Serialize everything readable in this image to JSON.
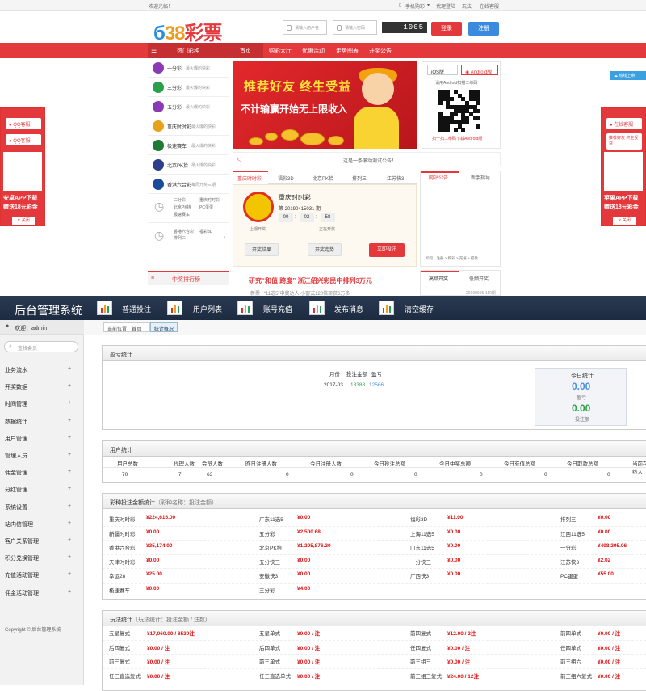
{
  "store": {
    "welcome": "欢迎光临！",
    "top_links": [
      "手机购彩",
      "代理登陆",
      "玩法",
      "在线客服"
    ],
    "logo": {
      "p1": "б",
      "p2": "38",
      "p3": "彩票"
    },
    "username_placeholder": "请输入用户名",
    "password_placeholder": "请输入密码",
    "captcha": "1005",
    "login_label": "登录",
    "register_label": "注册",
    "hot_lottery": "热门彩种",
    "nav": [
      "首页",
      "购彩大厅",
      "优惠活动",
      "走势图表",
      "开奖公告"
    ],
    "lotteries": [
      {
        "name": "一分彩",
        "desc": "最火爆的快彩",
        "color": "#8a3bb3"
      },
      {
        "name": "三分彩",
        "desc": "最火爆的快彩",
        "color": "#2aa04a"
      },
      {
        "name": "五分彩",
        "desc": "最火爆的快彩",
        "color": "#8a3bb3"
      },
      {
        "name": "重庆时时彩",
        "desc": "最火爆的快彩",
        "color": "#e6a21a"
      },
      {
        "name": "极速赛车",
        "desc": "最火爆的快彩",
        "color": "#1e7a34"
      },
      {
        "name": "北京PK拾",
        "desc": "最火爆的快彩",
        "color": "#2d3f8a"
      },
      {
        "name": "香港六合彩",
        "desc": "每周开奖三期",
        "color": "#1a4c9a"
      }
    ],
    "clock_items": [
      "三分彩",
      "重庆时时彩",
      "北京PK拾",
      "PC蛋蛋",
      "极速赛车"
    ],
    "clock_items2": [
      "香港六合彩",
      "福彩3D",
      "排列三"
    ],
    "rank_title": "中奖排行榜",
    "banner_line1": "推荐好友 终生受益",
    "banner_line2": "不计输赢开始无上限收入",
    "ios_label": "iOS版",
    "android_label": "Android版",
    "android_caption": "请用Android扫描二维码",
    "android_download": "扫一扫二维码下载Android版",
    "notice": "这是一条滚动测试公告！",
    "tabs": [
      "重庆时时彩",
      "福彩3D",
      "北京PK拾",
      "排列三",
      "江苏快3"
    ],
    "draw": {
      "name": "重庆时时彩",
      "issue": "第 20190415031 期",
      "timer": [
        "00",
        "02",
        "58"
      ],
      "prev_label": "上期开奖",
      "status": "正在开奖",
      "result_btn": "开奖结果",
      "trend_btn": "开奖走势",
      "bet_btn": "立即投注"
    },
    "news_tabs": [
      "网站公告",
      "新手指导"
    ],
    "news_links": "如何：注册 > 购彩 > 充值 > 提款",
    "headline": "研究“和值 跨度” 浙江绍兴彩民中排列3万元",
    "headline_sub": "新票  |  “11选5”中奖达人 小窗式120倍斩获6万多",
    "right_tabs": [
      "高频开奖",
      "低频开奖"
    ],
    "right_issue": "20190605-110期",
    "help_label": "热线上帝",
    "float_left": {
      "qq1": "QQ客服",
      "qq2": "QQ客服",
      "title": "安卓APP下载",
      "gift": "赠送18元彩金",
      "close": "关闭"
    },
    "float_right": {
      "qq1": "在线客服",
      "promo": "推荐好友 终生受益",
      "title": "苹果APP下载",
      "gift": "赠送18元彩金",
      "close": "关闭"
    }
  },
  "admin": {
    "title": "后台管理系统",
    "menu": [
      "普通投注",
      "用户列表",
      "账号充值",
      "发布消息",
      "清空缓存"
    ],
    "welcome": "欢迎：admin",
    "search_placeholder": "查找会员",
    "sidebar": [
      "业务流水",
      "开奖数据",
      "时间管理",
      "数据统计",
      "用户管理",
      "管理人员",
      "佣金管理",
      "分红管理",
      "系统设置",
      "站内信管理",
      "客户关系管理",
      "积分兑换管理",
      "充值活动管理",
      "佣金活动管理"
    ],
    "copyright": "Copyright © 后台管理系统",
    "crumb_label": "当前位置：首页",
    "crumb_tab": "统计概况",
    "profit": {
      "title": "盈亏统计",
      "headers": [
        "月份",
        "投注金额",
        "盈亏"
      ],
      "row": [
        "2017-03",
        "18388",
        "12566"
      ],
      "today_title": "今日统计",
      "today_profit": "0.00",
      "today_profit_label": "盈亏",
      "today_bet": "0.00",
      "today_bet_label": "投注额"
    },
    "users": {
      "title": "用户统计",
      "headers": [
        "用户总数",
        "代理人数",
        "会员人数",
        "昨日注册人数",
        "今日注册人数",
        "今日投注总额",
        "今日中奖总额",
        "今日充值总额",
        "今日取款总额",
        "当前在线人"
      ],
      "values": [
        "70",
        "7",
        "63",
        "0",
        "0",
        "0",
        "0",
        "0",
        "0",
        "0"
      ]
    },
    "lottery_stats": {
      "title": "彩种投注金额统计",
      "subtitle": "（彩种名称：投注金额）",
      "columns": [
        [
          [
            "重庆时时彩",
            "¥224,616.00"
          ],
          [
            "新疆时时彩",
            "¥0.00"
          ],
          [
            "香港六合彩",
            "¥35,174.00"
          ],
          [
            "天津时时彩",
            "¥0.00"
          ],
          [
            "幸运28",
            "¥25.00"
          ],
          [
            "极速赛车",
            "¥0.00"
          ]
        ],
        [
          [
            "广东11选5",
            "¥0.00"
          ],
          [
            "五分彩",
            "¥2,500.68"
          ],
          [
            "北京PK拾",
            "¥1,205,876.20"
          ],
          [
            "五分快三",
            "¥0.00"
          ],
          [
            "安徽快3",
            "¥0.00"
          ],
          [
            "三分彩",
            "¥4.00"
          ]
        ],
        [
          [
            "福彩3D",
            "¥11.00"
          ],
          [
            "上海11选5",
            "¥0.00"
          ],
          [
            "山东11选5",
            "¥0.00"
          ],
          [
            "一分快三",
            "¥0.00"
          ],
          [
            "广西快3",
            "¥0.00"
          ]
        ],
        [
          [
            "排列三",
            "¥0.00"
          ],
          [
            "江西11选5",
            "¥0.00"
          ],
          [
            "一分彩",
            "¥498,295.06"
          ],
          [
            "江苏快3",
            "¥2.02"
          ],
          [
            "PC蛋蛋",
            "¥55.00"
          ]
        ]
      ]
    },
    "play_stats": {
      "title": "玩法统计",
      "subtitle": "（玩法统计：投注金额 / 注数）",
      "columns": [
        [
          [
            "五星复式",
            "¥17,060.00 / 8530注"
          ],
          [
            "后四复式",
            "¥0.00 / 注"
          ],
          [
            "前三复式",
            "¥0.00 / 注"
          ],
          [
            "任三直选复式",
            "¥0.00 / 注"
          ]
        ],
        [
          [
            "五星单式",
            "¥0.00 / 注"
          ],
          [
            "后四单式",
            "¥0.00 / 注"
          ],
          [
            "前三单式",
            "¥0.00 / 注"
          ],
          [
            "任三直选单式",
            "¥0.00 / 注"
          ]
        ],
        [
          [
            "前四复式",
            "¥12.00 / 2注"
          ],
          [
            "任四复式",
            "¥0.00 / 注"
          ],
          [
            "前三组三",
            "¥0.00 / 注"
          ],
          [
            "前三组三复式",
            "¥24.00 / 12注"
          ]
        ],
        [
          [
            "前四单式",
            "¥0.00 / 注"
          ],
          [
            "任四单式",
            "¥0.00 / 注"
          ],
          [
            "前三组六",
            "¥0.00 / 注"
          ],
          [
            "前三组六复式",
            "¥0.00 / 注"
          ]
        ]
      ]
    }
  },
  "colors": {
    "brand_red": "#e4393c",
    "admin_navy": "#1f2e45",
    "green": "#2da24c",
    "blue": "#4a90e2",
    "money_red": "#e01010"
  }
}
